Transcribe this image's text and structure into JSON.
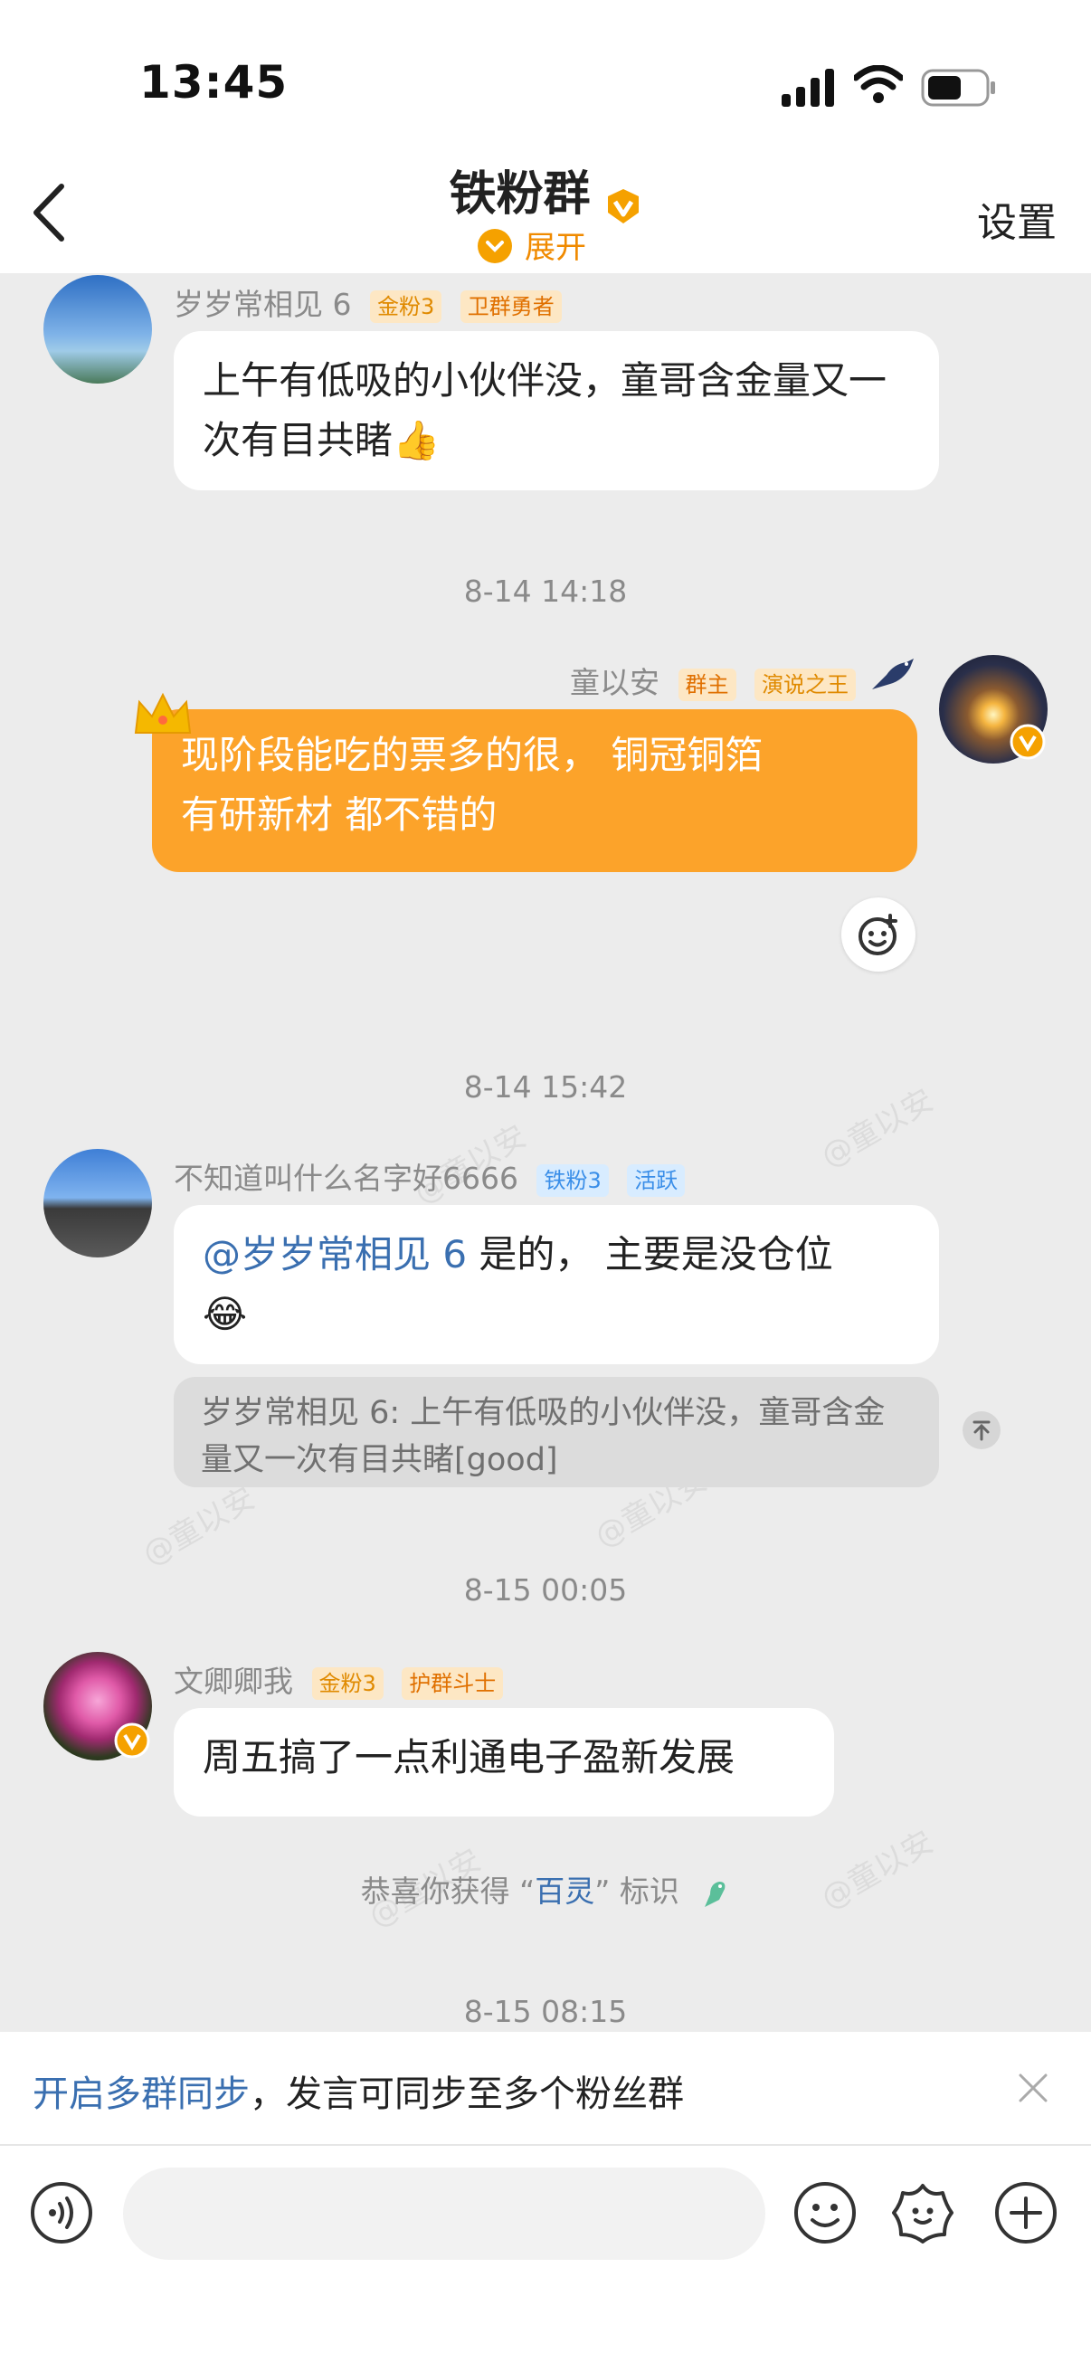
{
  "status_bar": {
    "time": "13:45"
  },
  "header": {
    "title": "铁粉群",
    "expand_label": "展开",
    "settings_label": "设置"
  },
  "messages": [
    {
      "user": "岁岁常相见 6",
      "tags": [
        "金粉3",
        "卫群勇者"
      ],
      "text": "上午有低吸的小伙伴没，童哥含金量又一次有目共睹👍"
    },
    {
      "timestamp": "8-14 14:18"
    },
    {
      "user": "童以安",
      "tags": [
        "群主",
        "演说之王"
      ],
      "text_line1": "现阶段能吃的票多的很，  铜冠铜箔",
      "text_line2": "有研新材 都不错的"
    },
    {
      "timestamp": "8-14 15:42"
    },
    {
      "user": "不知道叫什么名字好6666",
      "tags": [
        "铁粉3",
        "活跃"
      ],
      "mention": "@岁岁常相见 6",
      "text": " 是的， 主要是没仓位",
      "emoji": "😂",
      "quote": "岁岁常相见 6: 上午有低吸的小伙伴没，童哥含金量又一次有目共睹[good]"
    },
    {
      "timestamp": "8-15 00:05"
    },
    {
      "user": "文卿卿我",
      "tags": [
        "金粉3",
        "护群斗士"
      ],
      "text": "周五搞了一点利通电子盈新发展"
    },
    {
      "system_prefix": "恭喜你获得 “",
      "system_highlight": "百灵",
      "system_suffix": "” 标识"
    },
    {
      "timestamp": "8-15 08:15"
    }
  ],
  "watermark": "@童以安",
  "sync_banner": {
    "link": "开启多群同步",
    "text": "，发言可同步至多个粉丝群"
  },
  "colors": {
    "accent": "#fca32a",
    "link": "#3a6fb0",
    "background": "#ececec"
  },
  "icons": [
    "back-arrow-icon",
    "verified-v-icon",
    "chevron-down-icon",
    "voice-icon",
    "emoji-icon",
    "sticker-icon",
    "plus-icon",
    "close-icon",
    "add-reaction-icon",
    "scroll-top-icon",
    "crown-icon",
    "bird-icon"
  ]
}
